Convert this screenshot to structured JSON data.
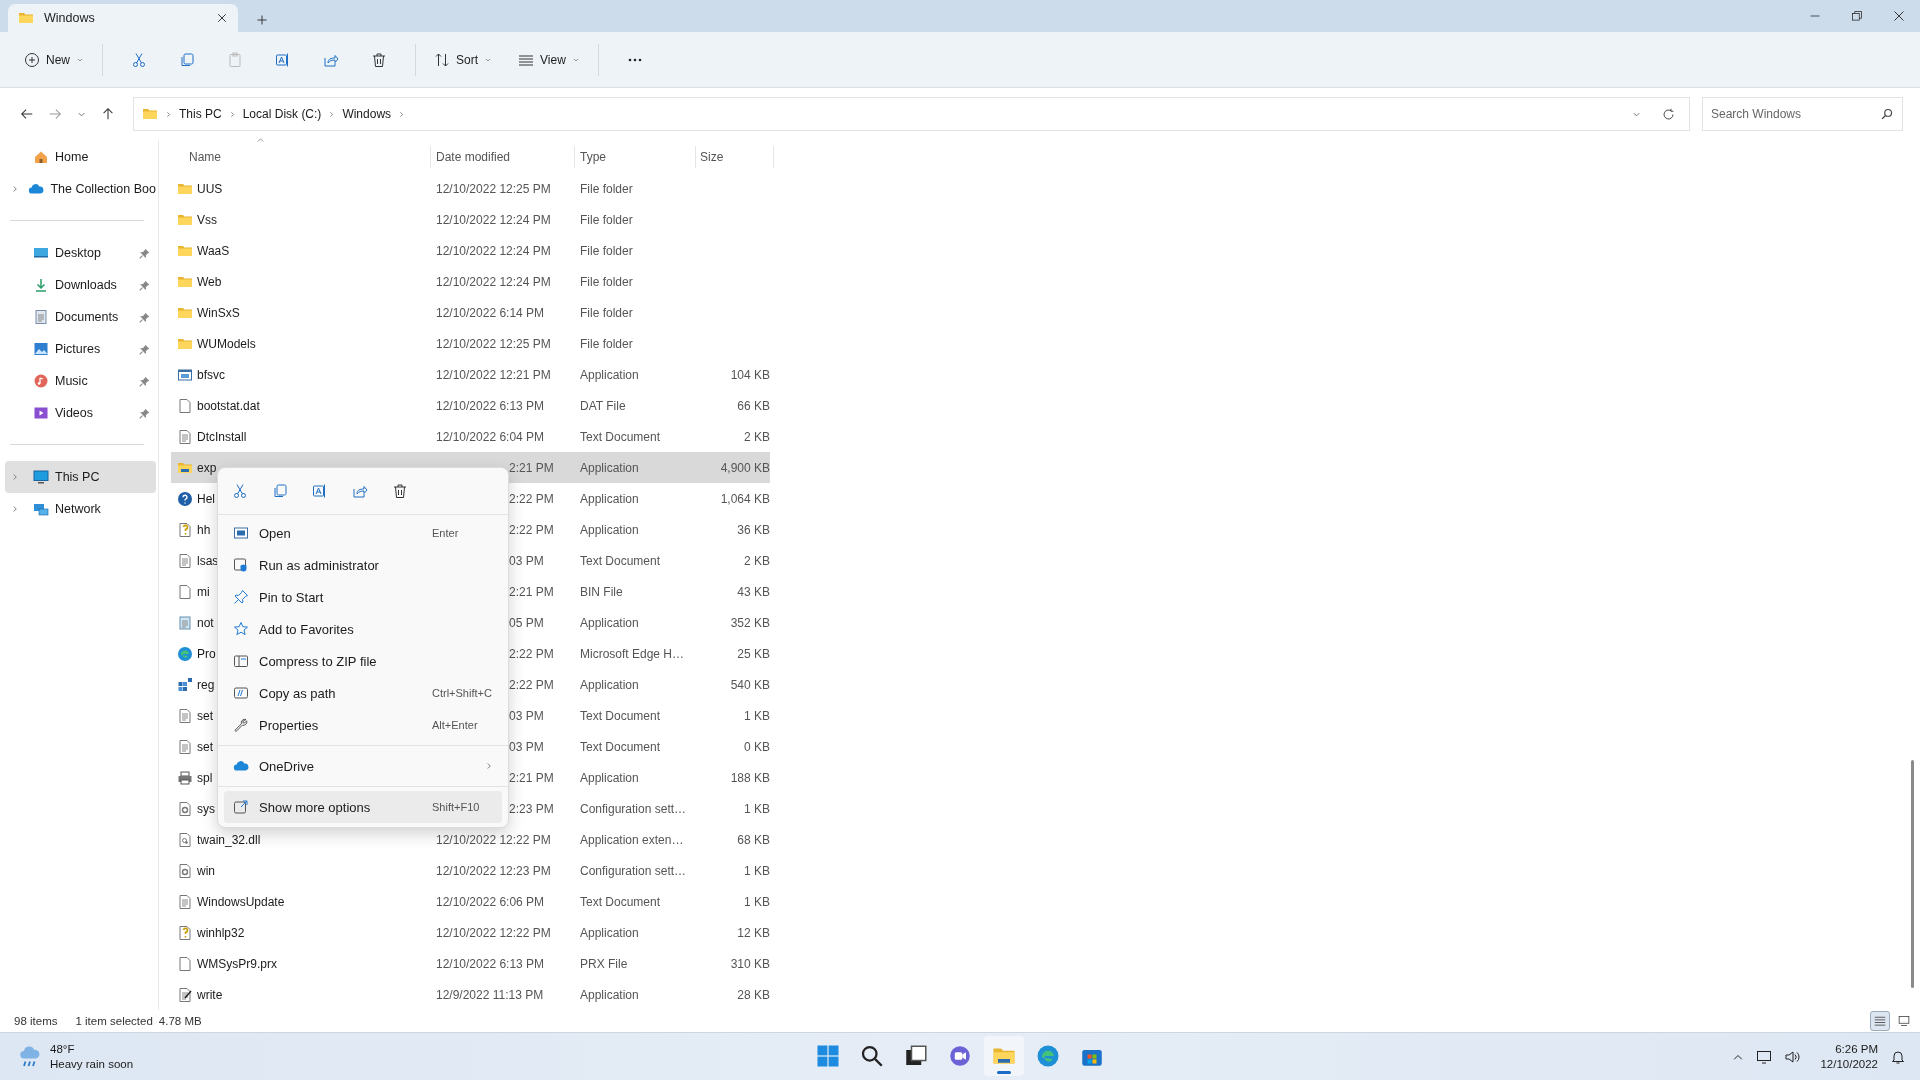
{
  "window": {
    "tab_title": "Windows"
  },
  "toolbar": {
    "new_label": "New",
    "sort_label": "Sort",
    "view_label": "View"
  },
  "address": {
    "crumbs": [
      "This PC",
      "Local Disk (C:)",
      "Windows"
    ],
    "search": {
      "placeholder": "Search Windows"
    }
  },
  "sidebar": {
    "sections": [
      [
        {
          "label": "Home",
          "kind": "home",
          "expandable": false,
          "pinned": false,
          "selected": false
        },
        {
          "label": "The Collection Boo",
          "kind": "cloud",
          "expandable": true,
          "pinned": false,
          "selected": false
        }
      ],
      [
        {
          "label": "Desktop",
          "kind": "desktop",
          "expandable": false,
          "pinned": true,
          "selected": false
        },
        {
          "label": "Downloads",
          "kind": "downloads",
          "expandable": false,
          "pinned": true,
          "selected": false
        },
        {
          "label": "Documents",
          "kind": "documents",
          "expandable": false,
          "pinned": true,
          "selected": false
        },
        {
          "label": "Pictures",
          "kind": "pictures",
          "expandable": false,
          "pinned": true,
          "selected": false
        },
        {
          "label": "Music",
          "kind": "music",
          "expandable": false,
          "pinned": true,
          "selected": false
        },
        {
          "label": "Videos",
          "kind": "videos",
          "expandable": false,
          "pinned": true,
          "selected": false
        }
      ],
      [
        {
          "label": "This PC",
          "kind": "pc",
          "expandable": true,
          "pinned": false,
          "selected": true
        },
        {
          "label": "Network",
          "kind": "network",
          "expandable": true,
          "pinned": false,
          "selected": false
        }
      ]
    ]
  },
  "table": {
    "columns": [
      {
        "label": "Name",
        "sorted": true
      },
      {
        "label": "Date modified",
        "sorted": false
      },
      {
        "label": "Type",
        "sorted": false
      },
      {
        "label": "Size",
        "sorted": false
      }
    ],
    "rows": [
      {
        "kind": "folder",
        "name": "UUS",
        "date": "12/10/2022 12:25 PM",
        "type": "File folder",
        "selected": false,
        "covered": false
      },
      {
        "kind": "folder",
        "name": "Vss",
        "date": "12/10/2022 12:24 PM",
        "type": "File folder",
        "selected": false,
        "covered": false
      },
      {
        "kind": "folder",
        "name": "WaaS",
        "date": "12/10/2022 12:24 PM",
        "type": "File folder",
        "selected": false,
        "covered": false
      },
      {
        "kind": "folder",
        "name": "Web",
        "date": "12/10/2022 12:24 PM",
        "type": "File folder",
        "selected": false,
        "covered": false
      },
      {
        "kind": "folder",
        "name": "WinSxS",
        "date": "12/10/2022 6:14 PM",
        "type": "File folder",
        "selected": false,
        "covered": false
      },
      {
        "kind": "folder",
        "name": "WUModels",
        "date": "12/10/2022 12:25 PM",
        "type": "File folder",
        "selected": false,
        "covered": false
      },
      {
        "kind": "app",
        "name": "bfsvc",
        "date": "12/10/2022 12:21 PM",
        "type": "Application",
        "size": "104 KB",
        "selected": false,
        "covered": false
      },
      {
        "kind": "file",
        "name": "bootstat.dat",
        "date": "12/10/2022 6:13 PM",
        "type": "DAT File",
        "size": "66 KB",
        "selected": false,
        "covered": false
      },
      {
        "kind": "text",
        "name": "DtcInstall",
        "date": "12/10/2022 6:04 PM",
        "type": "Text Document",
        "size": "2 KB",
        "selected": false,
        "covered": false
      },
      {
        "kind": "explorer",
        "name": "exp",
        "date": "2:21 PM",
        "type": "Application",
        "size": "4,900 KB",
        "selected": true,
        "covered": true
      },
      {
        "kind": "help",
        "name": "Hel",
        "date": "2:22 PM",
        "type": "Application",
        "size": "1,064 KB",
        "selected": false,
        "covered": true
      },
      {
        "kind": "helpfile",
        "name": "hh",
        "date": "2:22 PM",
        "type": "Application",
        "size": "36 KB",
        "selected": false,
        "covered": true
      },
      {
        "kind": "text",
        "name": "lsas",
        "date": "03 PM",
        "type": "Text Document",
        "size": "2 KB",
        "selected": false,
        "covered": true
      },
      {
        "kind": "file",
        "name": "mi",
        "date": "2:21 PM",
        "type": "BIN File",
        "size": "43 KB",
        "selected": false,
        "covered": true
      },
      {
        "kind": "notepad",
        "name": "not",
        "date": "05 PM",
        "type": "Application",
        "size": "352 KB",
        "selected": false,
        "covered": true
      },
      {
        "kind": "edge",
        "name": "Pro",
        "date": "2:22 PM",
        "type": "Microsoft Edge H…",
        "size": "25 KB",
        "selected": false,
        "covered": true
      },
      {
        "kind": "registry",
        "name": "reg",
        "date": "2:22 PM",
        "type": "Application",
        "size": "540 KB",
        "selected": false,
        "covered": true
      },
      {
        "kind": "text",
        "name": "set",
        "date": "03 PM",
        "type": "Text Document",
        "size": "1 KB",
        "selected": false,
        "covered": true
      },
      {
        "kind": "text",
        "name": "set",
        "date": "03 PM",
        "type": "Text Document",
        "size": "0 KB",
        "selected": false,
        "covered": true
      },
      {
        "kind": "printer",
        "name": "spl",
        "date": "2:21 PM",
        "type": "Application",
        "size": "188 KB",
        "selected": false,
        "covered": true
      },
      {
        "kind": "config",
        "name": "sys",
        "date": "2:23 PM",
        "type": "Configuration sett…",
        "size": "1 KB",
        "selected": false,
        "covered": true
      },
      {
        "kind": "dll",
        "name": "twain_32.dll",
        "date": "12/10/2022 12:22 PM",
        "type": "Application exten…",
        "size": "68 KB",
        "selected": false,
        "covered": false
      },
      {
        "kind": "config",
        "name": "win",
        "date": "12/10/2022 12:23 PM",
        "type": "Configuration sett…",
        "size": "1 KB",
        "selected": false,
        "covered": false
      },
      {
        "kind": "text",
        "name": "WindowsUpdate",
        "date": "12/10/2022 6:06 PM",
        "type": "Text Document",
        "size": "1 KB",
        "selected": false,
        "covered": false
      },
      {
        "kind": "helpfile",
        "name": "winhlp32",
        "date": "12/10/2022 12:22 PM",
        "type": "Application",
        "size": "12 KB",
        "selected": false,
        "covered": false
      },
      {
        "kind": "file",
        "name": "WMSysPr9.prx",
        "date": "12/10/2022 6:13 PM",
        "type": "PRX File",
        "size": "310 KB",
        "selected": false,
        "covered": false
      },
      {
        "kind": "write",
        "name": "write",
        "date": "12/9/2022 11:13 PM",
        "type": "Application",
        "size": "28 KB",
        "selected": false,
        "covered": false
      }
    ]
  },
  "context_menu": {
    "groups": [
      [
        {
          "kind": "open",
          "label": "Open",
          "shortcut": "Enter",
          "selected": false
        },
        {
          "kind": "admin",
          "label": "Run as administrator",
          "selected": false
        },
        {
          "kind": "pin",
          "label": "Pin to Start",
          "selected": false
        },
        {
          "kind": "favorite",
          "label": "Add to Favorites",
          "selected": false
        },
        {
          "kind": "zip",
          "label": "Compress to ZIP file",
          "selected": false
        },
        {
          "kind": "path",
          "label": "Copy as path",
          "shortcut": "Ctrl+Shift+C",
          "selected": false
        },
        {
          "kind": "properties",
          "label": "Properties",
          "shortcut": "Alt+Enter",
          "selected": false
        }
      ],
      [
        {
          "kind": "cloud",
          "label": "OneDrive",
          "submenu": true,
          "selected": false
        }
      ],
      [
        {
          "kind": "more",
          "label": "Show more options",
          "shortcut": "Shift+F10",
          "selected": true
        }
      ]
    ]
  },
  "status_bar": {
    "item_count": "98 items",
    "selection": "1 item selected",
    "selection_size": "4.78 MB",
    "views": [
      {
        "kind": "details",
        "selected": true
      },
      {
        "kind": "tiles",
        "selected": false
      }
    ]
  },
  "taskbar": {
    "weather": {
      "temperature": "48°F",
      "forecast": "Heavy rain soon"
    },
    "apps": [
      {
        "kind": "start",
        "selected": false
      },
      {
        "kind": "search",
        "selected": false
      },
      {
        "kind": "taskview",
        "selected": false
      },
      {
        "kind": "chat",
        "selected": false
      },
      {
        "kind": "explorer",
        "selected": true
      },
      {
        "kind": "edge",
        "selected": false
      },
      {
        "kind": "store",
        "selected": false
      }
    ],
    "clock": {
      "time": "6:26 PM",
      "date": "12/10/2022"
    }
  }
}
